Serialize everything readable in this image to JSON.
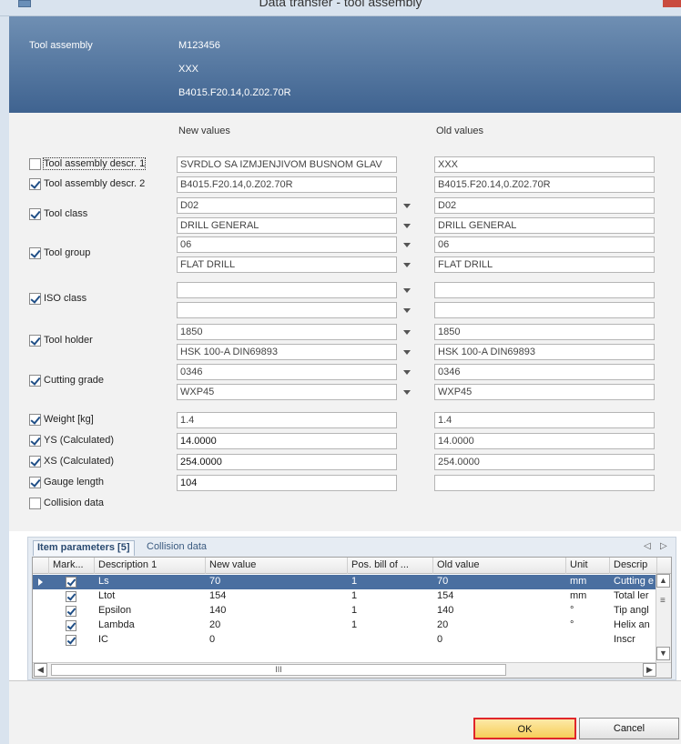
{
  "window": {
    "title": "Data transfer - tool assembly"
  },
  "header": {
    "label": "Tool assembly",
    "line1": "M123456",
    "line2": "XXX",
    "line3": "B4015.F20.14,0.Z02.70R"
  },
  "columns": {
    "new": "New values",
    "old": "Old values"
  },
  "rows": [
    {
      "label": "Tool assembly descr. 1",
      "checked": false,
      "new": [
        "SVRDLO SA IZMJENJIVOM BUSNOM GLAV"
      ],
      "old": [
        "XXX"
      ],
      "dropdown": false
    },
    {
      "label": "Tool assembly descr. 2",
      "checked": true,
      "new": [
        "B4015.F20.14,0.Z02.70R"
      ],
      "old": [
        "B4015.F20.14,0.Z02.70R"
      ],
      "dropdown": false
    },
    {
      "label": "Tool class",
      "checked": true,
      "new": [
        "D02",
        "DRILL GENERAL"
      ],
      "old": [
        "D02",
        "DRILL GENERAL"
      ],
      "dropdown": true
    },
    {
      "label": "Tool group",
      "checked": true,
      "new": [
        "06",
        "FLAT DRILL"
      ],
      "old": [
        "06",
        "FLAT DRILL"
      ],
      "dropdown": true
    },
    {
      "label": "ISO class",
      "checked": true,
      "new": [
        "",
        ""
      ],
      "old": [
        "",
        ""
      ],
      "dropdown": true
    },
    {
      "label": "Tool holder",
      "checked": true,
      "new": [
        "1850",
        "HSK 100-A DIN69893"
      ],
      "old": [
        "1850",
        "HSK 100-A DIN69893"
      ],
      "dropdown": true
    },
    {
      "label": "Cutting grade",
      "checked": true,
      "new": [
        "0346",
        "WXP45"
      ],
      "old": [
        "0346",
        "WXP45"
      ],
      "dropdown": true
    },
    {
      "label": "Weight [kg]",
      "checked": true,
      "new": [
        "1.4"
      ],
      "old": [
        "1.4"
      ],
      "dropdown": false
    },
    {
      "label": "YS (Calculated)",
      "checked": true,
      "new": [
        "14.0000"
      ],
      "old": [
        "14.0000"
      ],
      "dropdown": false
    },
    {
      "label": "XS (Calculated)",
      "checked": true,
      "new": [
        "254.0000"
      ],
      "old": [
        "254.0000"
      ],
      "dropdown": false
    },
    {
      "label": "Gauge length",
      "checked": true,
      "new": [
        "104"
      ],
      "old": [
        ""
      ],
      "dropdown": false
    },
    {
      "label": "Collision data",
      "checked": false,
      "new": [],
      "old": [],
      "dropdown": false
    }
  ],
  "tabs": {
    "tab1": "Item parameters [5]",
    "tab2": "Collision data",
    "nav_left": "◁",
    "nav_right": "▷"
  },
  "grid": {
    "headers": [
      "Mark...",
      "Description 1",
      "New value",
      "Pos. bill of ...",
      "Old value",
      "Unit",
      "Descrip"
    ],
    "rows": [
      {
        "desc": "Ls",
        "new": "70",
        "pos": "1",
        "old": "70",
        "unit": "mm",
        "descr": "Cutting e"
      },
      {
        "desc": "Ltot",
        "new": "154",
        "pos": "1",
        "old": "154",
        "unit": "mm",
        "descr": "Total ler"
      },
      {
        "desc": "Epsilon",
        "new": "140",
        "pos": "1",
        "old": "140",
        "unit": "°",
        "descr": "Tip angl"
      },
      {
        "desc": "Lambda",
        "new": "20",
        "pos": "1",
        "old": "20",
        "unit": "°",
        "descr": "Helix an"
      },
      {
        "desc": "IC",
        "new": "0",
        "pos": "",
        "old": "0",
        "unit": "",
        "descr": "Inscr"
      }
    ],
    "hscroll_grip": "III"
  },
  "buttons": {
    "ok": "OK",
    "cancel": "Cancel"
  }
}
